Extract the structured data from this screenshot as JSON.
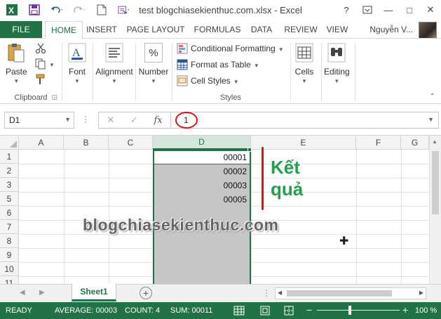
{
  "window": {
    "title": "test blogchiasekienthuc.com.xlsx - Excel",
    "help": "?",
    "restore_icon": "ribbon-display-icon",
    "min": "—",
    "max": "□",
    "close": "✕"
  },
  "ribbon_tabs": {
    "file": "FILE",
    "tabs": [
      "HOME",
      "INSERT",
      "PAGE LAYOUT",
      "FORMULAS",
      "DATA",
      "REVIEW",
      "VIEW"
    ],
    "user": "Nguyễn V..."
  },
  "ribbon": {
    "clipboard": {
      "paste": "Paste",
      "label": "Clipboard"
    },
    "font": {
      "label": "Font"
    },
    "alignment": {
      "label": "Alignment"
    },
    "number": {
      "label": "Number",
      "symbol": "%"
    },
    "styles": {
      "conditional": "Conditional Formatting",
      "format_table": "Format as Table",
      "cell_styles": "Cell Styles",
      "label": "Styles"
    },
    "cells": {
      "label": "Cells"
    },
    "editing": {
      "label": "Editing"
    }
  },
  "formula_bar": {
    "name_box": "D1",
    "fx": "fx",
    "value": "1"
  },
  "grid": {
    "columns": [
      "A",
      "B",
      "C",
      "D",
      "E",
      "F",
      "G"
    ],
    "rows": [
      "1",
      "2",
      "3",
      "5",
      "6",
      "7",
      "8",
      "9",
      "10",
      "11"
    ],
    "d_values": [
      "00001",
      "00002",
      "00003",
      "00005"
    ],
    "annotation_line1": "Kết",
    "annotation_line2": "quả",
    "watermark": "blogchiasekienthuc.com"
  },
  "sheets": {
    "active": "Sheet1",
    "add": "+"
  },
  "status": {
    "ready": "READY",
    "average": "AVERAGE: 00003",
    "count": "COUNT: 4",
    "sum": "SUM: 00011",
    "zoom_out": "−",
    "zoom_in": "+",
    "zoom": "100 %"
  },
  "colors": {
    "accent": "#217346",
    "annotation": "#22a04a",
    "highlight": "#e01010"
  }
}
